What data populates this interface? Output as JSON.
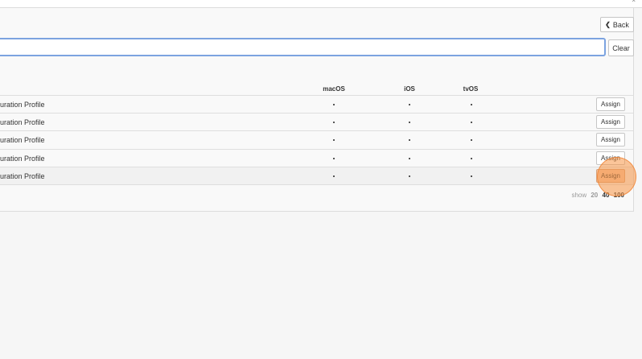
{
  "toolbar": {
    "back_label": "Back",
    "back_icon": "chevron-left-icon",
    "corner_mark": "×"
  },
  "search": {
    "value": "",
    "placeholder": "",
    "clear_label": "Clear"
  },
  "table": {
    "columns": [
      "macOS",
      "iOS",
      "tvOS"
    ],
    "rows": [
      {
        "name": "uration Profile",
        "macos": "•",
        "ios": "•",
        "tvos": "•",
        "action": "Assign"
      },
      {
        "name": "uration Profile",
        "macos": "•",
        "ios": "•",
        "tvos": "•",
        "action": "Assign"
      },
      {
        "name": "uration Profile",
        "macos": "•",
        "ios": "•",
        "tvos": "•",
        "action": "Assign"
      },
      {
        "name": "uration Profile",
        "macos": "•",
        "ios": "•",
        "tvos": "•",
        "action": "Assign"
      },
      {
        "name": "uration Profile",
        "macos": "•",
        "ios": "•",
        "tvos": "•",
        "action": "Assign"
      }
    ]
  },
  "pagination": {
    "label": "show",
    "options": [
      "20",
      "40",
      "100"
    ],
    "selected": "40"
  },
  "colors": {
    "focus_border": "#7ca3e0",
    "highlight": "#f79646"
  }
}
